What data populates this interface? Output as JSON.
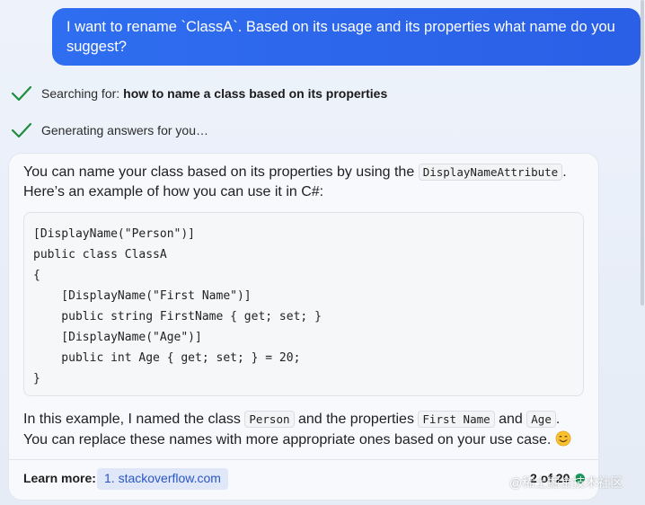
{
  "user_message": {
    "text": "I want to rename `ClassA`. Based on its usage and its properties what name do you suggest?"
  },
  "status": [
    {
      "prefix": "Searching for:",
      "query": "how to name a class based on its properties",
      "icon": "checkmark-icon"
    },
    {
      "prefix": "Generating answers for you…",
      "query": "",
      "icon": "checkmark-icon"
    }
  ],
  "answer": {
    "intro_before": "You can name your class based on its properties by using the",
    "intro_code": "DisplayNameAttribute",
    "intro_after": ".",
    "intro_line2": "Here’s an example of how you can use it in C#:",
    "code_lines": [
      "[DisplayName(\"Person\")]",
      "public class ClassA",
      "{",
      "    [DisplayName(\"First Name\")]",
      "    public string FirstName { get; set; }",
      "    [DisplayName(\"Age\")]",
      "    public int Age { get; set; } = 20;",
      "}"
    ],
    "outro_1": "In this example, I named the class",
    "outro_code_1": "Person",
    "outro_2": "and the properties",
    "outro_code_2": "First Name",
    "outro_3": "and",
    "outro_code_3": "Age",
    "outro_4": ".",
    "outro_line2": "You can replace these names with more appropriate ones based on your use case.",
    "emoji_icon": "smiling-face-icon"
  },
  "footer": {
    "learn_more_label": "Learn more:",
    "source_link": "1. stackoverflow.com",
    "page_counter": "2 of 20"
  },
  "watermark": "@稀土掘金技术社区",
  "colors": {
    "user_bubble": "#2f6ef0",
    "check": "#1e8e3e",
    "link": "#2a56c6",
    "status_dot": "#1a9a5a"
  }
}
